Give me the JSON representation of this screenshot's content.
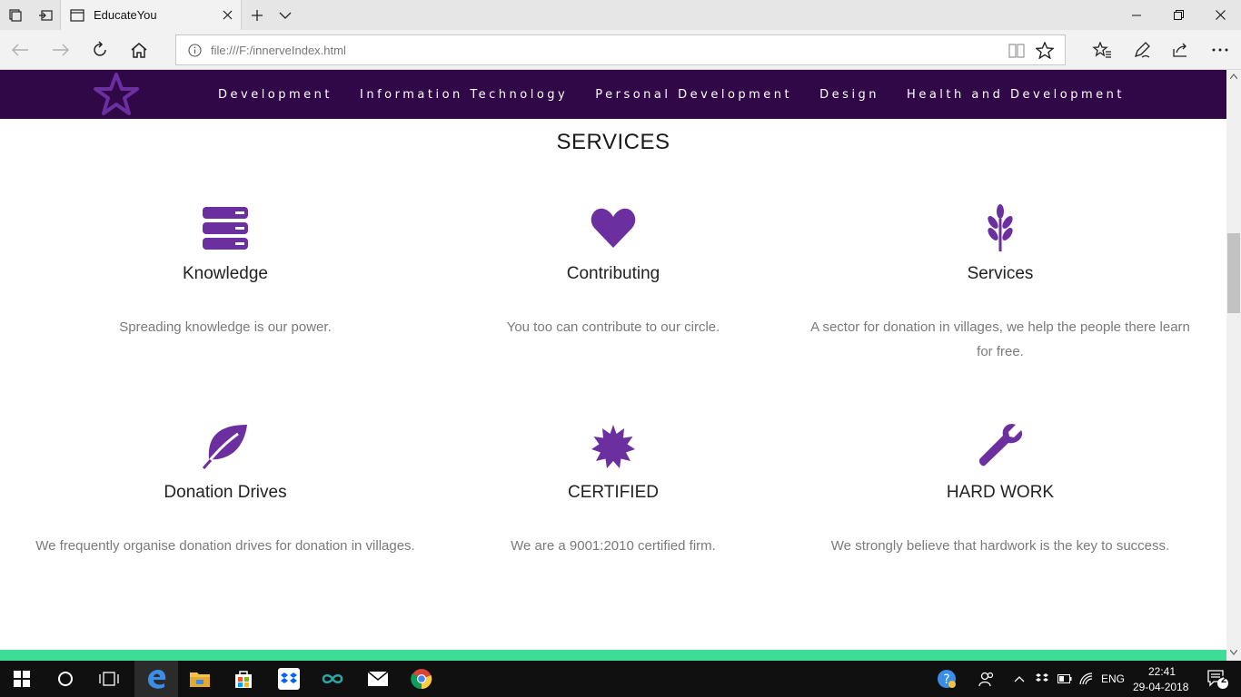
{
  "browser": {
    "tab_title": "EducateYou",
    "url": "file:///F:/innerveIndex.html"
  },
  "site": {
    "nav_items": [
      "Development",
      "Information Technology",
      "Personal Development",
      "Design",
      "Health and Development"
    ],
    "section_title": "SERVICES",
    "services": [
      {
        "title": "Knowledge",
        "description": "Spreading knowledge is our power.",
        "icon": "server-stack-icon"
      },
      {
        "title": "Contributing",
        "description": "You too can contribute to our circle.",
        "icon": "heart-icon"
      },
      {
        "title": "Services",
        "description": "A sector for donation in villages, we help the people there learn for free.",
        "icon": "grain-icon"
      },
      {
        "title": "Donation Drives",
        "description": "We frequently organise donation drives for donation in villages.",
        "icon": "leaf-icon"
      },
      {
        "title": "CERTIFIED",
        "description": "We are a 9001:2010 certified firm.",
        "icon": "badge-icon"
      },
      {
        "title": "HARD WORK",
        "description": "We strongly believe that hardwork is the key to success.",
        "icon": "wrench-icon"
      }
    ]
  },
  "taskbar": {
    "language": "ENG",
    "time": "22:41",
    "date": "29-04-2018",
    "notifications": "2"
  },
  "colors": {
    "nav_bg": "#300848",
    "icon_purple": "#6b2fa0",
    "accent_teal": "#3ddc97"
  }
}
